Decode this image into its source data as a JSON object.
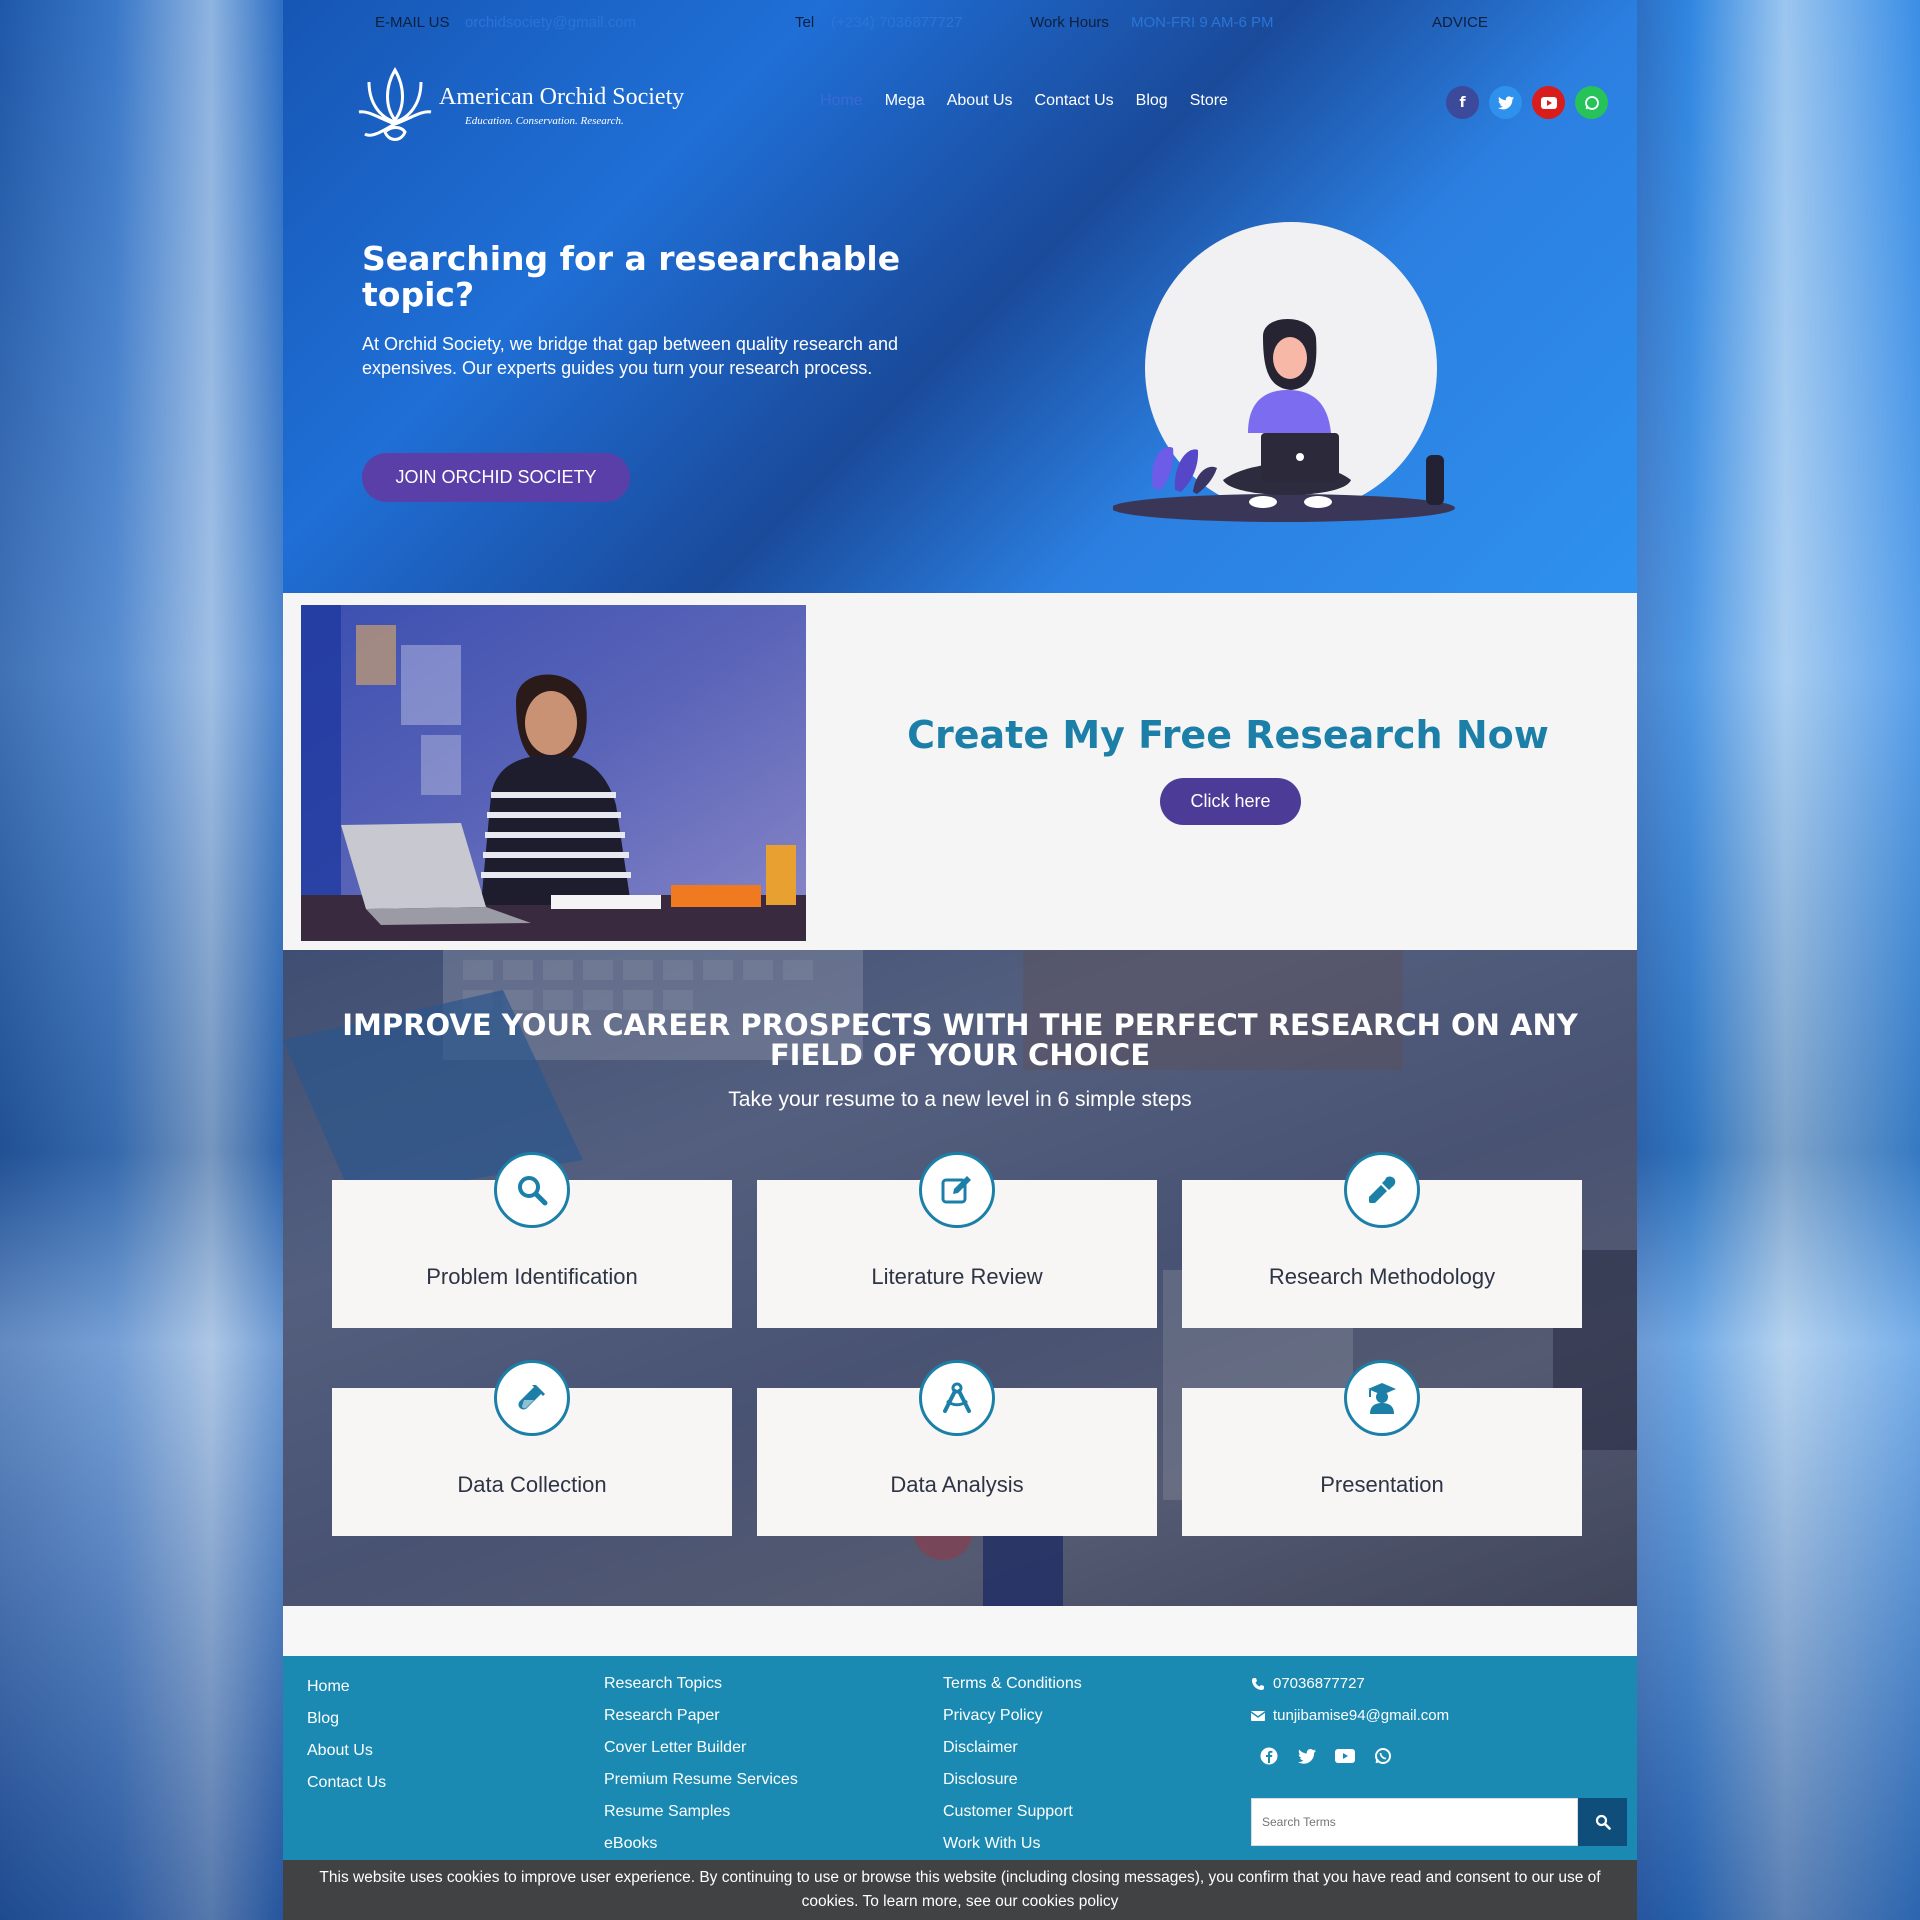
{
  "topbar": {
    "email_label": "E-MAIL US",
    "email_value": "orchidsociety@gmail.com",
    "tel_label": "Tel",
    "tel_value": "(+234) 7036877727",
    "hours_label": "Work Hours",
    "hours_value": "MON-FRI 9 AM-6 PM",
    "advice": "ADVICE"
  },
  "logo": {
    "name": "American Orchid Society",
    "tagline": "Education. Conservation. Research."
  },
  "nav": {
    "items": [
      "Home",
      "Mega",
      "About Us",
      "Contact Us",
      "Blog",
      "Store"
    ],
    "active": "Home"
  },
  "social": [
    {
      "icon": "facebook-icon",
      "color": "#3b4a9a"
    },
    {
      "icon": "twitter-icon",
      "color": "#2f91ee"
    },
    {
      "icon": "youtube-icon",
      "color": "#d91c1c"
    },
    {
      "icon": "whatsapp-icon",
      "color": "#25c35a"
    }
  ],
  "hero": {
    "title": "Searching for a researchable topic?",
    "text": " At Orchid Society, we bridge that gap between quality research and expensives. Our experts guides you turn your research process.",
    "button": "JOIN ORCHID SOCIETY"
  },
  "cta": {
    "title": "Create My Free Research Now",
    "button": "Click here"
  },
  "steps": {
    "title": "IMPROVE YOUR CAREER PROSPECTS WITH THE PERFECT RESEARCH ON ANY FIELD OF YOUR CHOICE",
    "subtitle": "Take your resume to a new level in 6 simple steps",
    "items": [
      {
        "label": "Problem Identification",
        "icon": "search-icon"
      },
      {
        "label": "Literature Review",
        "icon": "edit-icon"
      },
      {
        "label": "Research Methodology",
        "icon": "eyedropper-icon"
      },
      {
        "label": "Data Collection",
        "icon": "test-tube-icon"
      },
      {
        "label": "Data Analysis",
        "icon": "drafting-compass-icon"
      },
      {
        "label": "Presentation",
        "icon": "graduate-icon"
      }
    ]
  },
  "footer": {
    "col1": [
      "Home",
      "Blog",
      "About Us",
      "Contact Us"
    ],
    "col2": [
      "Research Topics",
      "Research Paper",
      "Cover Letter Builder",
      "Premium Resume Services",
      "Resume Samples",
      "eBooks"
    ],
    "col3": [
      "Terms & Conditions",
      "Privacy Policy",
      "Disclaimer",
      "Disclosure",
      "Customer Support",
      "Work With Us"
    ],
    "phone": "07036877727",
    "email": "tunjibamise94@gmail.com",
    "search_placeholder": "Search Terms"
  },
  "cookie": {
    "text": "This website uses cookies to improve user experience. By continuing to use or browse this website (including closing messages), you confirm that you have read and consent to our use of cookies. To learn more, see our cookies policy"
  },
  "colors": {
    "brand_blue": "#2f91ee",
    "teal": "#1c7fa8",
    "purple_button": "#5a3fa8",
    "footer": "#1a8ab2",
    "cookie_bar": "#414244"
  }
}
